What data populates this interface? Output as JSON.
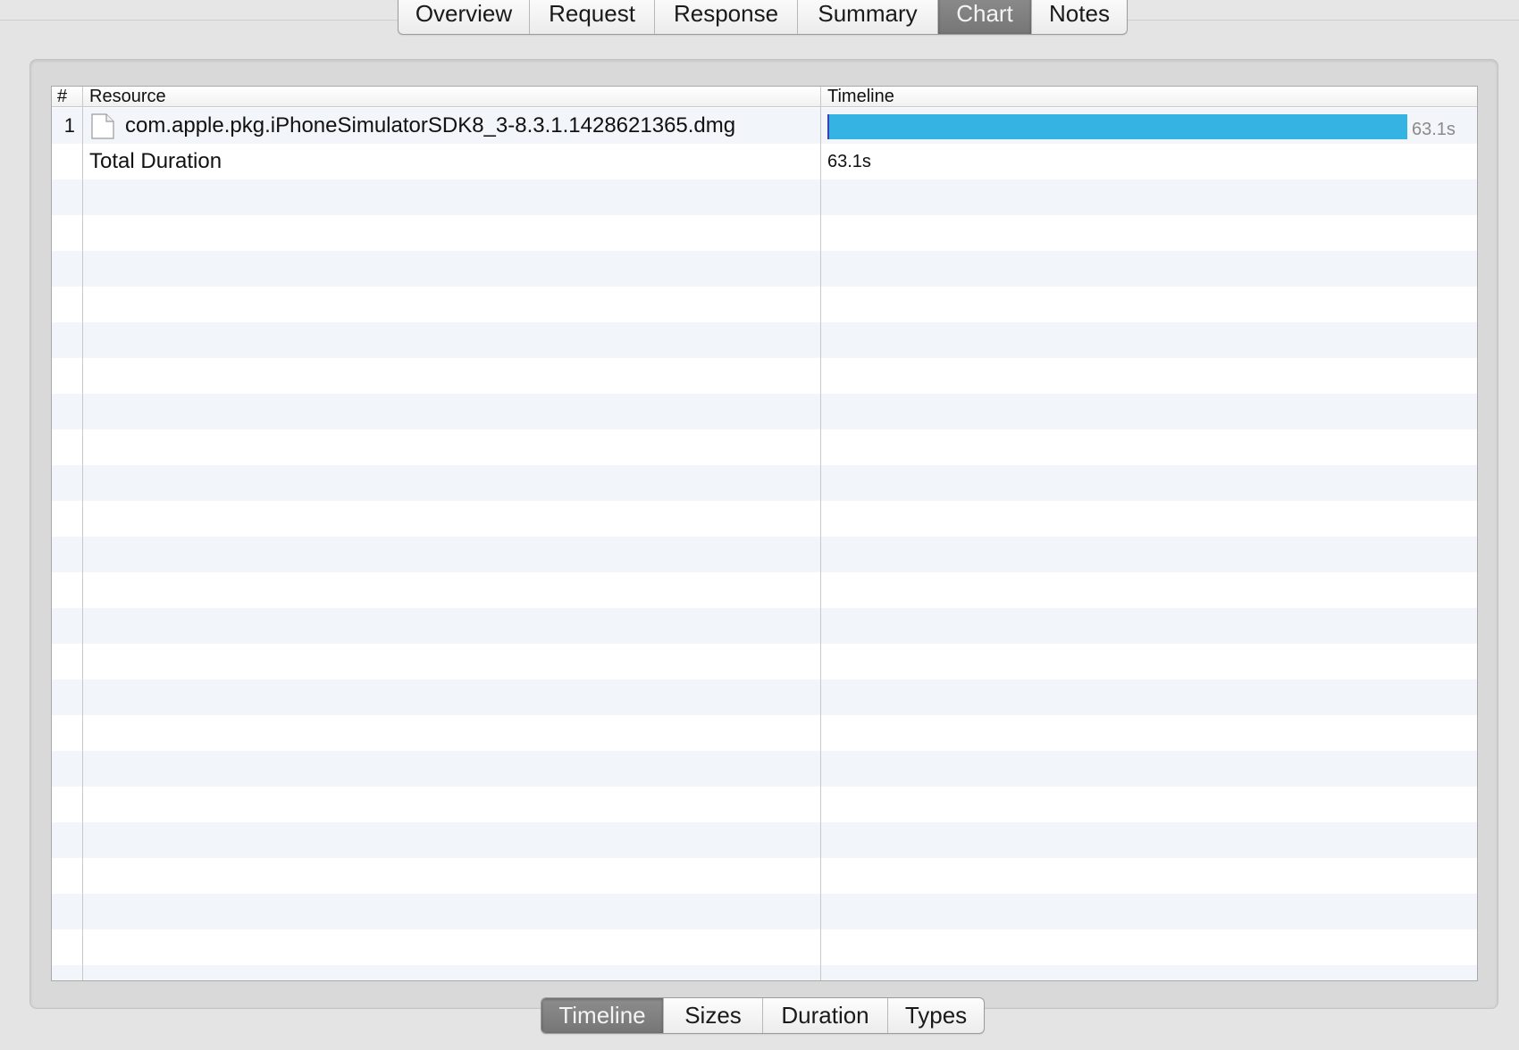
{
  "top_tabs": [
    {
      "label": "Overview",
      "active": false
    },
    {
      "label": "Request",
      "active": false
    },
    {
      "label": "Response",
      "active": false
    },
    {
      "label": "Summary",
      "active": false
    },
    {
      "label": "Chart",
      "active": true
    },
    {
      "label": "Notes",
      "active": false
    }
  ],
  "table": {
    "columns": {
      "num": "#",
      "resource": "Resource",
      "timeline": "Timeline"
    },
    "rows": [
      {
        "num": "1",
        "resource": "com.apple.pkg.iPhoneSimulatorSDK8_3-8.3.1.1428621365.dmg",
        "icon": "document-icon",
        "duration_label": "63.1s",
        "timeline_fraction": 1.0
      }
    ],
    "total": {
      "label": "Total Duration",
      "value": "63.1s"
    }
  },
  "bottom_tabs": [
    {
      "label": "Timeline",
      "active": true
    },
    {
      "label": "Sizes",
      "active": false
    },
    {
      "label": "Duration",
      "active": false
    },
    {
      "label": "Types",
      "active": false
    }
  ],
  "colors": {
    "bar": "#35b3e2",
    "bar_start": "#3b3fb8",
    "row_alt": "#f2f5f9"
  }
}
